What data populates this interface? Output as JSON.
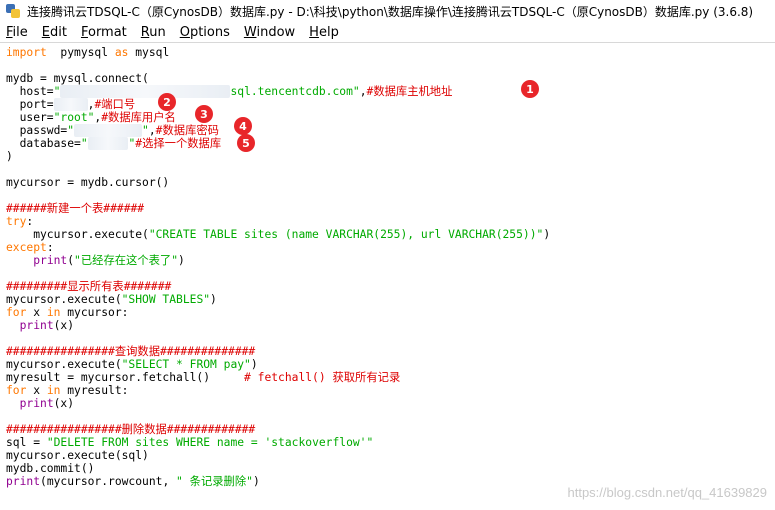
{
  "window": {
    "title": "连接腾讯云TDSQL-C（原CynosDB）数据库.py - D:\\科技\\python\\数据库操作\\连接腾讯云TDSQL-C（原CynosDB）数据库.py (3.6.8)"
  },
  "menu": [
    {
      "label": "File",
      "underline": "F",
      "rest": "ile"
    },
    {
      "label": "Edit",
      "underline": "E",
      "rest": "dit"
    },
    {
      "label": "Format",
      "underline": "F",
      "rest": "ormat"
    },
    {
      "label": "Run",
      "underline": "R",
      "rest": "un"
    },
    {
      "label": "Options",
      "underline": "O",
      "rest": "ptions"
    },
    {
      "label": "Window",
      "underline": "W",
      "rest": "indow"
    },
    {
      "label": "Help",
      "underline": "H",
      "rest": "elp"
    }
  ],
  "code": [
    [
      [
        "kw",
        "import"
      ],
      [
        "t",
        "  pymysql "
      ],
      [
        "kw",
        "as"
      ],
      [
        "t",
        " mysql"
      ]
    ],
    [],
    [
      [
        "t",
        "mydb = mysql.connect("
      ]
    ],
    [
      [
        "t",
        "  host="
      ],
      [
        "str",
        "\""
      ],
      [
        "blur",
        "                         "
      ],
      [
        "str",
        "sql.tencentcdb.com\""
      ],
      [
        "t",
        ","
      ],
      [
        "cm",
        "#数据库主机地址"
      ]
    ],
    [
      [
        "t",
        "  port="
      ],
      [
        "blur",
        "     "
      ],
      [
        "t",
        ","
      ],
      [
        "cm",
        "#端口号"
      ]
    ],
    [
      [
        "t",
        "  user="
      ],
      [
        "str",
        "\"root\""
      ],
      [
        "t",
        ","
      ],
      [
        "cm",
        "#数据库用户名"
      ]
    ],
    [
      [
        "t",
        "  passwd="
      ],
      [
        "str",
        "\""
      ],
      [
        "blur",
        "          "
      ],
      [
        "str",
        "\""
      ],
      [
        "t",
        ","
      ],
      [
        "cm",
        "#数据库密码"
      ]
    ],
    [
      [
        "t",
        "  database="
      ],
      [
        "str",
        "\""
      ],
      [
        "blur",
        "      "
      ],
      [
        "str",
        "\""
      ],
      [
        "cm",
        "#选择一个数据库"
      ]
    ],
    [
      [
        "t",
        ")"
      ]
    ],
    [],
    [
      [
        "t",
        "mycursor = mydb.cursor()"
      ]
    ],
    [],
    [
      [
        "cm",
        "######新建一个表######"
      ]
    ],
    [
      [
        "kw",
        "try"
      ],
      [
        "t",
        ":"
      ]
    ],
    [
      [
        "t",
        "    mycursor.execute("
      ],
      [
        "str",
        "\"CREATE TABLE sites (name VARCHAR(255), url VARCHAR(255))\""
      ],
      [
        "t",
        ")"
      ]
    ],
    [
      [
        "kw",
        "except"
      ],
      [
        "t",
        ":"
      ]
    ],
    [
      [
        "t",
        "    "
      ],
      [
        "bi",
        "print"
      ],
      [
        "t",
        "("
      ],
      [
        "str",
        "\"已经存在这个表了\""
      ],
      [
        "t",
        ")"
      ]
    ],
    [],
    [
      [
        "cm",
        "#########显示所有表#######"
      ]
    ],
    [
      [
        "t",
        "mycursor.execute("
      ],
      [
        "str",
        "\"SHOW TABLES\""
      ],
      [
        "t",
        ")"
      ]
    ],
    [
      [
        "kw",
        "for"
      ],
      [
        "t",
        " x "
      ],
      [
        "kw",
        "in"
      ],
      [
        "t",
        " mycursor:"
      ]
    ],
    [
      [
        "t",
        "  "
      ],
      [
        "bi",
        "print"
      ],
      [
        "t",
        "(x)"
      ]
    ],
    [],
    [
      [
        "cm",
        "################查询数据##############"
      ]
    ],
    [
      [
        "t",
        "mycursor.execute("
      ],
      [
        "str",
        "\"SELECT * FROM pay\""
      ],
      [
        "t",
        ")"
      ]
    ],
    [
      [
        "t",
        "myresult = mycursor.fetchall()     "
      ],
      [
        "cm",
        "# fetchall() 获取所有记录"
      ]
    ],
    [
      [
        "kw",
        "for"
      ],
      [
        "t",
        " x "
      ],
      [
        "kw",
        "in"
      ],
      [
        "t",
        " myresult:"
      ]
    ],
    [
      [
        "t",
        "  "
      ],
      [
        "bi",
        "print"
      ],
      [
        "t",
        "(x)"
      ]
    ],
    [],
    [
      [
        "cm",
        "#################删除数据#############"
      ]
    ],
    [
      [
        "t",
        "sql = "
      ],
      [
        "str",
        "\"DELETE FROM sites WHERE name = 'stackoverflow'\""
      ]
    ],
    [
      [
        "t",
        "mycursor.execute(sql)"
      ]
    ],
    [
      [
        "t",
        "mydb.commit()"
      ]
    ],
    [
      [
        "bi",
        "print"
      ],
      [
        "t",
        "(mycursor.rowcount, "
      ],
      [
        "str",
        "\" 条记录删除\""
      ],
      [
        "t",
        ")"
      ]
    ]
  ],
  "badges": [
    "1",
    "2",
    "3",
    "4",
    "5"
  ],
  "watermark": "https://blog.csdn.net/qq_41639829"
}
